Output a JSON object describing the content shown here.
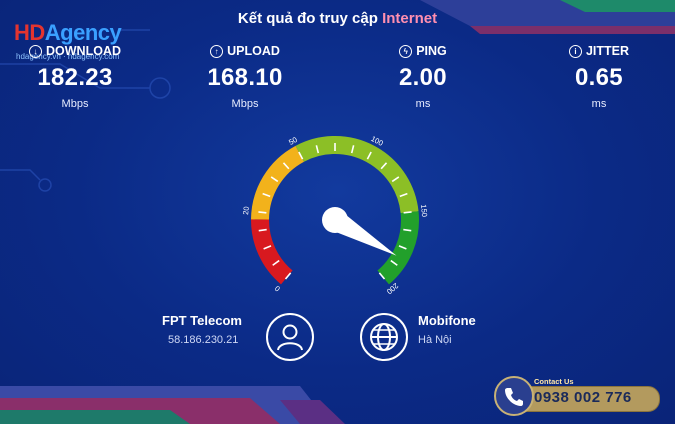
{
  "header": {
    "title_prefix": "Kết quả đo truy cập ",
    "title_highlight": "Internet"
  },
  "logo": {
    "brand_hd": "HD",
    "brand_agency": "Agency",
    "tagline": "hdagency.vn · hdagency.com"
  },
  "metrics": [
    {
      "label": "DOWNLOAD",
      "icon": "download-icon",
      "value": "182.23",
      "unit": "Mbps"
    },
    {
      "label": "UPLOAD",
      "icon": "upload-icon",
      "value": "168.10",
      "unit": "Mbps"
    },
    {
      "label": "PING",
      "icon": "ping-icon",
      "value": "2.00",
      "unit": "ms"
    },
    {
      "label": "JITTER",
      "icon": "info-icon",
      "value": "0.65",
      "unit": "ms"
    }
  ],
  "gauge": {
    "ticks": [
      "0",
      "20",
      "50",
      "100",
      "150",
      "200"
    ],
    "value": 182.23,
    "max": 200,
    "colors": {
      "red": "#d8191f",
      "yellow": "#f2b21b",
      "lightgreen": "#8cbf26",
      "green": "#22a02b"
    }
  },
  "client": {
    "isp": "FPT Telecom",
    "ip": "58.186.230.21"
  },
  "server": {
    "name": "Mobifone",
    "location": "Hà Nội"
  },
  "contact": {
    "label": "Contact Us",
    "phone": "0938 002 776"
  },
  "colors": {
    "background": "#0b2a86",
    "accent": "#ff8fb0"
  }
}
